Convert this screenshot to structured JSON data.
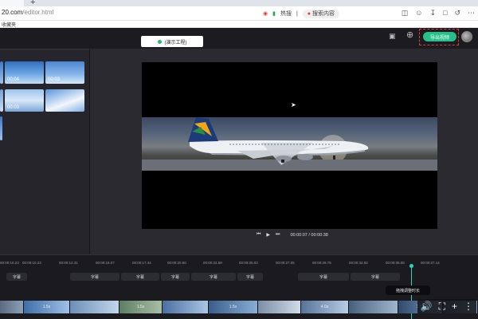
{
  "browser": {
    "new_tab_symbol": "+",
    "url_host": "20.com",
    "url_path": "/editor.html",
    "favorite_label": "收藏夹",
    "toolbar_items": [
      "个人",
      "•••"
    ],
    "search_hot_label": "热搜",
    "search_label": "搜索内容"
  },
  "header": {
    "project_name": "(演示工程)",
    "export_label": "导出视频"
  },
  "media": {
    "thumbnails": [
      {
        "label": ""
      },
      {
        "label": "00:04"
      },
      {
        "label": "00:03"
      },
      {
        "label": ""
      },
      {
        "label": "00:03"
      },
      {
        "label": ""
      }
    ]
  },
  "player": {
    "current_time": "00:00:07",
    "total_time": "00:00:38",
    "time_display": "00:00:07 / 00:00:38"
  },
  "timeline": {
    "ticks": [
      "00:00:10.23",
      "00:00:12.31",
      "00:00:15.07",
      "00:00:17.44",
      "00:00:20.50",
      "00:00:22.59",
      "00:00:25.03",
      "00:00:27.05",
      "00:00:29.75",
      "00:00:32.82",
      "00:00:35.08",
      "00:00:37.14"
    ],
    "subtitles": [
      "字幕",
      "字幕",
      "字幕",
      "字幕",
      "字幕",
      "字幕",
      "字幕",
      "字幕",
      "字幕"
    ],
    "tooltip": "拖拽调整时长",
    "segments": [
      "",
      "1.5s",
      "",
      "1.5s",
      "",
      "1.5s",
      "",
      "4.0s",
      "",
      "1.5s",
      ""
    ]
  },
  "colors": {
    "accent": "#27c08a",
    "highlight": "#e03a3a",
    "playhead": "#2fd1c1"
  },
  "icons": [
    "save-icon",
    "add-icon",
    "play-icon",
    "prev-icon",
    "next-icon",
    "volume-icon",
    "fullscreen-icon",
    "more-icon"
  ]
}
